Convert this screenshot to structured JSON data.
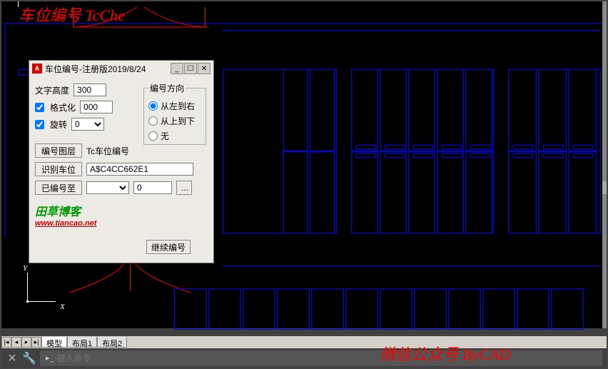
{
  "overlay": {
    "title": "车位编号 TcChe",
    "footer": "微信公众号 ByCAD"
  },
  "dialog": {
    "title": "车位编号-注册版2019/8/24",
    "text_height_label": "文字高度",
    "text_height_value": "300",
    "format_label": "格式化",
    "format_checked": true,
    "format_value": "000",
    "rotate_label": "旋转",
    "rotate_checked": true,
    "rotate_value": "0",
    "direction": {
      "legend": "编号方向",
      "opt1": "从左到右",
      "opt2": "从上到下",
      "opt3": "无",
      "selected": "opt1"
    },
    "layer_btn": "编号图层",
    "layer_value": "Tc车位编号",
    "ident_btn": "识别车位",
    "ident_value": "A$C4CC662E1",
    "numbered_btn": "已编号至",
    "numbered_combo": "",
    "numbered_num": "0",
    "more_btn": "...",
    "continue_btn": "继续编号",
    "logo_text": "田草博客",
    "logo_url": "www.tiancao.net"
  },
  "tabs": {
    "items": [
      "模型",
      "布局1",
      "布局2"
    ],
    "active": 0
  },
  "cmd": {
    "prompt": "▸_",
    "placeholder": "键入命令"
  },
  "ucs": {
    "y": "Y",
    "x": "X"
  }
}
